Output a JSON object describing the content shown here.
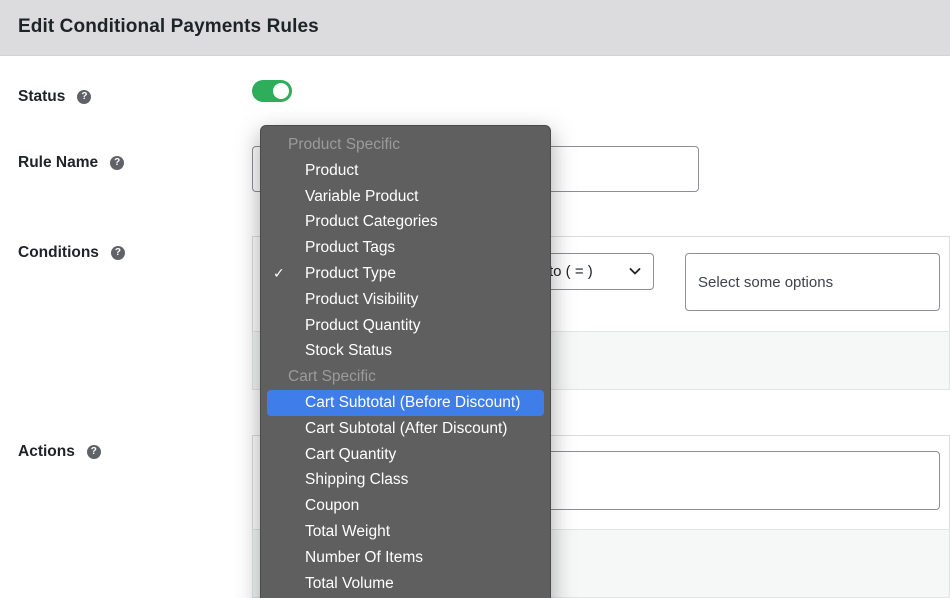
{
  "header": {
    "title": "Edit Conditional Payments Rules"
  },
  "labels": {
    "status": "Status",
    "rule_name": "Rule Name",
    "conditions": "Conditions",
    "actions": "Actions"
  },
  "help_icon_glyph": "?",
  "status_toggle": {
    "on": true,
    "color": "#2ead5b"
  },
  "conditions": {
    "operator_value": "to ( = )",
    "options_placeholder": "Select some options"
  },
  "dropdown": {
    "highlight_color": "#3f7ee8",
    "groups": [
      {
        "label": "Product Specific",
        "items": [
          {
            "label": "Product",
            "checked": false,
            "highlighted": false
          },
          {
            "label": "Variable Product",
            "checked": false,
            "highlighted": false
          },
          {
            "label": "Product Categories",
            "checked": false,
            "highlighted": false
          },
          {
            "label": "Product Tags",
            "checked": false,
            "highlighted": false
          },
          {
            "label": "Product Type",
            "checked": true,
            "highlighted": false
          },
          {
            "label": "Product Visibility",
            "checked": false,
            "highlighted": false
          },
          {
            "label": "Product Quantity",
            "checked": false,
            "highlighted": false
          },
          {
            "label": "Stock Status",
            "checked": false,
            "highlighted": false
          }
        ]
      },
      {
        "label": "Cart Specific",
        "items": [
          {
            "label": "Cart Subtotal (Before Discount)",
            "checked": false,
            "highlighted": true
          },
          {
            "label": "Cart Subtotal (After Discount)",
            "checked": false,
            "highlighted": false
          },
          {
            "label": "Cart Quantity",
            "checked": false,
            "highlighted": false
          },
          {
            "label": "Shipping Class",
            "checked": false,
            "highlighted": false
          },
          {
            "label": "Coupon",
            "checked": false,
            "highlighted": false
          },
          {
            "label": "Total Weight",
            "checked": false,
            "highlighted": false
          },
          {
            "label": "Number Of Items",
            "checked": false,
            "highlighted": false
          },
          {
            "label": "Total Volume",
            "checked": false,
            "highlighted": false
          }
        ]
      }
    ]
  }
}
